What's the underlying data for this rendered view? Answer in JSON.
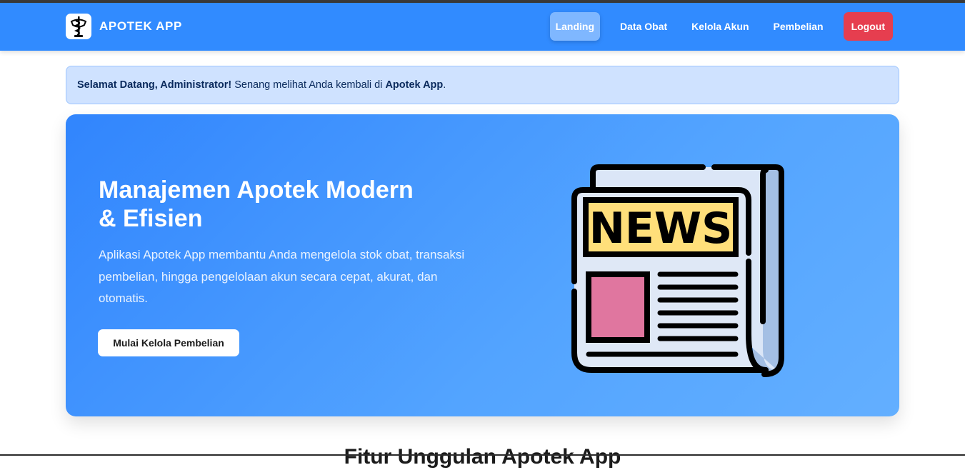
{
  "navbar": {
    "brand": "APOTEK APP",
    "items": [
      {
        "label": "Landing",
        "active": true
      },
      {
        "label": "Data Obat"
      },
      {
        "label": "Kelola Akun"
      },
      {
        "label": "Pembelian"
      }
    ],
    "logout_label": "Logout"
  },
  "alert": {
    "greeting": "Selamat Datang, Administrator!",
    "message": " Senang melihat Anda kembali di ",
    "app_name": "Apotek App",
    "suffix": "."
  },
  "hero": {
    "title_line1": "Manajemen Apotek Modern",
    "title_line2": "& Efisien",
    "description": "Aplikasi Apotek App membantu Anda mengelola stok obat, transaksi pembelian, hingga pengelolaan akun secara cepat, akurat, dan otomatis.",
    "button_label": "Mulai Kelola Pembelian",
    "illustration_text": "NEWS"
  },
  "features": {
    "heading": "Fitur Unggulan Apotek App"
  },
  "colors": {
    "navbar": "#318bff",
    "logout": "#e63e4f",
    "alert_bg": "#cfe2ff",
    "hero_start": "#3185fd",
    "hero_end": "#63afff",
    "news_banner": "#ffdf7a",
    "news_photo": "#e0769f"
  },
  "icons": {
    "brand_logo": "pharmacy-bowl-snake-icon",
    "hero_illustration": "newspaper-icon"
  }
}
